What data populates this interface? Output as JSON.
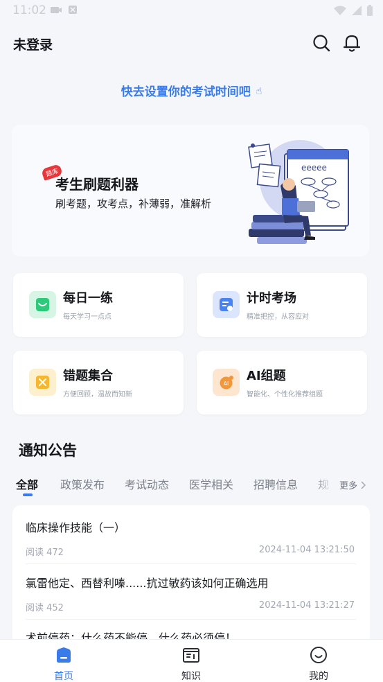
{
  "status_bar": {
    "time": "11:02"
  },
  "header": {
    "login_status": "未登录",
    "search_icon": "search-icon",
    "bell_icon": "bell-icon"
  },
  "exam_hint": {
    "text": "快去设置你的考试时间吧",
    "icon": "hand-pointer-icon"
  },
  "banner": {
    "tag": "题库",
    "title": "考生刷题利器",
    "subtitle": "刷考题，攻考点，补薄弱，准解析"
  },
  "features": [
    {
      "title": "每日一练",
      "subtitle": "每天学习一点点",
      "icon": "calendar-check-icon",
      "color": "#2fc97a",
      "bg": "#d6f5e4"
    },
    {
      "title": "计时考场",
      "subtitle": "精准把控，从容应对",
      "icon": "timer-paper-icon",
      "color": "#4a82f0",
      "bg": "#dbe6fd"
    },
    {
      "title": "错题集合",
      "subtitle": "方便回顾，温故而知新",
      "icon": "wrong-answer-icon",
      "color": "#f6b62d",
      "bg": "#fdf0cf"
    },
    {
      "title": "AI组题",
      "subtitle": "智能化、个性化推荐组题",
      "icon": "ai-icon",
      "color": "#f0973e",
      "bg": "#fde6cf",
      "icon_text": "AI"
    }
  ],
  "notices": {
    "heading": "通知公告",
    "tabs": [
      "全部",
      "政策发布",
      "考试动态",
      "医学相关",
      "招聘信息",
      "规"
    ],
    "active_tab": 0,
    "more_label": "更多",
    "items": [
      {
        "title": "临床操作技能（一）",
        "reads": "阅读 472",
        "time": "2024-11-04 13:21:50"
      },
      {
        "title": "氯雷他定、西替利嗪......抗过敏药该如何正确选用",
        "reads": "阅读 452",
        "time": "2024-11-04 13:21:27"
      },
      {
        "title": "术前停药：什么药不能停，什么药必须停！",
        "reads": "",
        "time": ""
      }
    ]
  },
  "bottom_nav": [
    {
      "label": "首页",
      "icon": "home-icon",
      "active": true
    },
    {
      "label": "知识",
      "icon": "book-icon",
      "active": false
    },
    {
      "label": "我的",
      "icon": "profile-smile-icon",
      "active": false
    }
  ],
  "colors": {
    "accent": "#3a7bea",
    "background": "#f4f6fa"
  }
}
